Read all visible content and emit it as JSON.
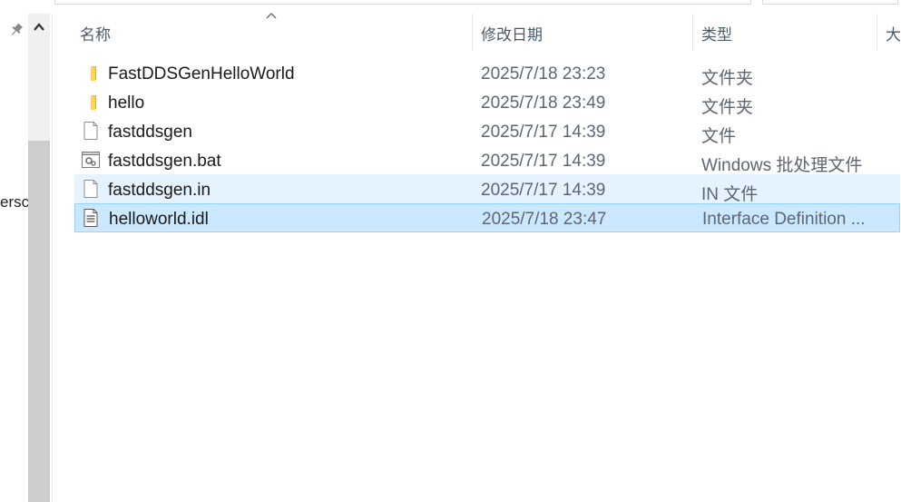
{
  "header": {
    "sort_arrow": "^",
    "col_name": "名称",
    "col_date": "修改日期",
    "col_type": "类型",
    "col_size": "大"
  },
  "nav": {
    "cut_label": "ersc"
  },
  "files": [
    {
      "name": "FastDDSGenHelloWorld",
      "date": "2025/7/18 23:23",
      "type": "文件夹",
      "icon": "folder-icon"
    },
    {
      "name": "hello",
      "date": "2025/7/18 23:49",
      "type": "文件夹",
      "icon": "folder-icon"
    },
    {
      "name": "fastddsgen",
      "date": "2025/7/17 14:39",
      "type": "文件",
      "icon": "blank-file-icon"
    },
    {
      "name": "fastddsgen.bat",
      "date": "2025/7/17 14:39",
      "type": "Windows 批处理文件",
      "icon": "batch-file-icon"
    },
    {
      "name": "fastddsgen.in",
      "date": "2025/7/17 14:39",
      "type": "IN 文件",
      "icon": "blank-file-icon"
    },
    {
      "name": "helloworld.idl",
      "date": "2025/7/18 23:47",
      "type": "Interface Definition ...",
      "icon": "text-file-icon"
    }
  ],
  "colors": {
    "hover_bg": "#e5f3ff",
    "selected_bg": "#cce8ff",
    "selected_border": "#99d1ff"
  }
}
